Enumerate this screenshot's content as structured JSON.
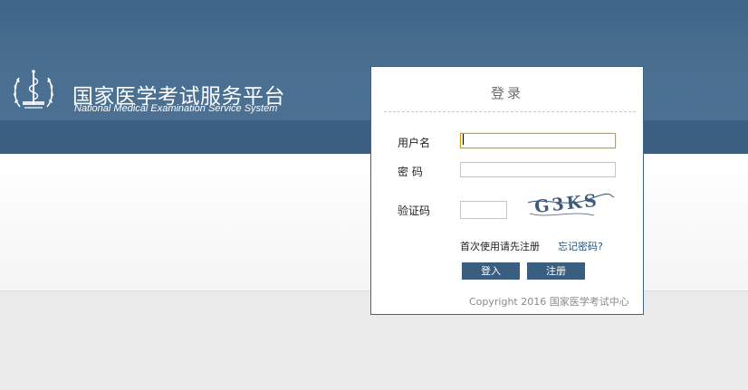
{
  "header": {
    "title_cn": "国家医学考试服务平台",
    "title_en": "National Medical Examination Service System"
  },
  "login": {
    "title": "登录",
    "username_label": "用户名",
    "username_value": "",
    "password_label": "密 码",
    "password_value": "",
    "captcha_label": "验证码",
    "captcha_value": "",
    "captcha_text": "G3KS",
    "first_use_hint": "首次使用请先注册",
    "forgot_password": "忘记密码?",
    "login_button": "登入",
    "register_button": "注册",
    "copyright": "Copyright 2016 国家医学考试中心"
  },
  "colors": {
    "header_bg": "#4a6f91",
    "header_band": "#3a5f80",
    "button_bg": "#3a5e7f",
    "link": "#21527a",
    "active_input_border": "#d8a000"
  },
  "icons": {
    "logo": "medical-caduceus-emblem"
  }
}
